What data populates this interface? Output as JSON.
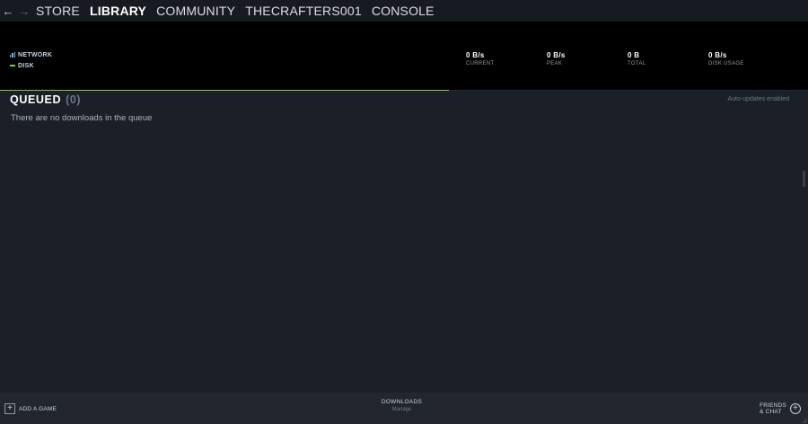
{
  "nav": {
    "back_icon": "arrow-left-icon",
    "forward_icon": "arrow-right-icon",
    "items": [
      {
        "label": "STORE",
        "active": false
      },
      {
        "label": "LIBRARY",
        "active": true
      },
      {
        "label": "COMMUNITY",
        "active": false
      },
      {
        "label": "THECRAFTERS001",
        "active": false
      },
      {
        "label": "CONSOLE",
        "active": false
      }
    ]
  },
  "graph": {
    "legend": {
      "network": "NETWORK",
      "disk": "DISK"
    },
    "stats": [
      {
        "value": "0 B/s",
        "label": "CURRENT"
      },
      {
        "value": "0 B/s",
        "label": "PEAK"
      },
      {
        "value": "0 B",
        "label": "TOTAL"
      },
      {
        "value": "0 B/s",
        "label": "DISK USAGE"
      }
    ],
    "colors": {
      "network": "#66c0f4",
      "disk": "#8bc34a"
    },
    "progress_fraction": 0.556
  },
  "queue": {
    "title": "QUEUED",
    "count": "(0)",
    "auto_updates": "Auto-updates enabled",
    "empty_message": "There are no downloads in the queue"
  },
  "bottom": {
    "add_game": "ADD A GAME",
    "downloads": "DOWNLOADS",
    "downloads_sub": "Manage",
    "friends_line1": "FRIENDS",
    "friends_line2": "& CHAT"
  }
}
